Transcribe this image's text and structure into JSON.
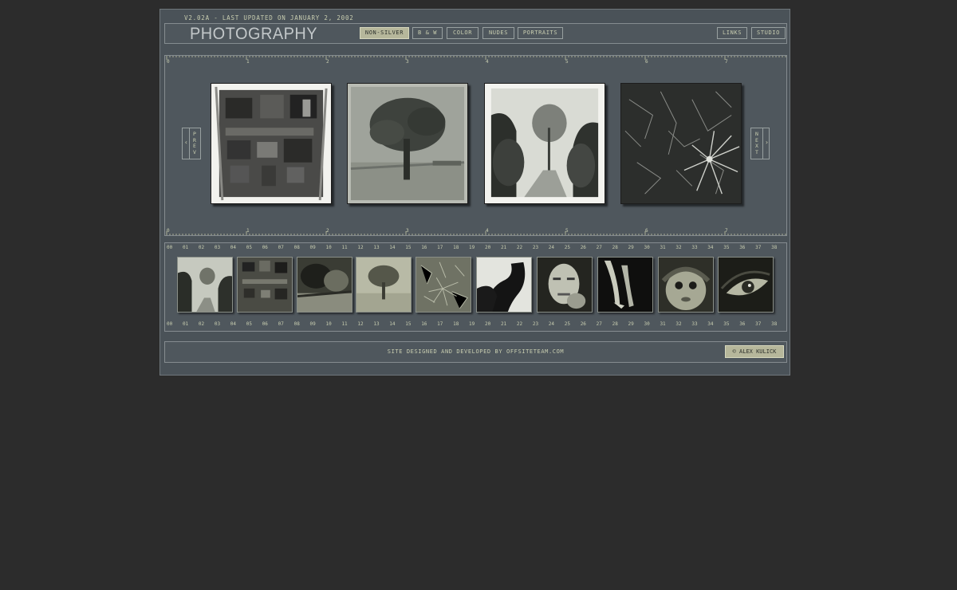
{
  "header": {
    "version": "v2.02a - last updated on january 2, 2002",
    "logo": "PHOTOGRAPHY"
  },
  "nav": {
    "categories": [
      {
        "label": "non-silver",
        "active": true
      },
      {
        "label": "b & w",
        "active": false
      },
      {
        "label": "color",
        "active": false
      },
      {
        "label": "nudes",
        "active": false
      },
      {
        "label": "portraits",
        "active": false
      }
    ],
    "links": [
      {
        "label": "links"
      },
      {
        "label": "studio"
      }
    ]
  },
  "viewer": {
    "ruler_numbers": [
      "0",
      "1",
      "2",
      "3",
      "4",
      "5",
      "6",
      "7"
    ],
    "prev": {
      "arrow": "‹",
      "letters": [
        "p",
        "r",
        "e",
        "v"
      ]
    },
    "next": {
      "arrow": "›",
      "letters": [
        "n",
        "e",
        "x",
        "t"
      ]
    },
    "photos": [
      {
        "icon": "ruined-building-photo"
      },
      {
        "icon": "lone-tree-photo"
      },
      {
        "icon": "tree-lined-road-photo"
      },
      {
        "icon": "frost-crystals-photo"
      }
    ]
  },
  "strip": {
    "frame_numbers": [
      "00",
      "01",
      "02",
      "03",
      "04",
      "05",
      "06",
      "07",
      "08",
      "09",
      "10",
      "11",
      "12",
      "13",
      "14",
      "15",
      "16",
      "17",
      "18",
      "19",
      "20",
      "21",
      "22",
      "23",
      "24",
      "25",
      "26",
      "27",
      "28",
      "29",
      "30",
      "31",
      "32",
      "33",
      "34",
      "35",
      "36",
      "37",
      "38"
    ],
    "thumbnails": [
      {
        "icon": "tree-road-thumb"
      },
      {
        "icon": "ruined-building-thumb"
      },
      {
        "icon": "dark-landscape-thumb"
      },
      {
        "icon": "lone-tree-thumb"
      },
      {
        "icon": "frost-crystals-thumb"
      },
      {
        "icon": "nude-silhouette-thumb"
      },
      {
        "icon": "man-portrait-thumb"
      },
      {
        "icon": "crossed-legs-thumb"
      },
      {
        "icon": "child-portrait-thumb"
      },
      {
        "icon": "eye-closeup-thumb"
      }
    ]
  },
  "footer": {
    "credit_prefix": "site designed and developed by",
    "credit_link": "offsiteteam.com",
    "copyright": "© alex kulick"
  },
  "colors": {
    "background": "#2c2c2c",
    "panel": "#4a5258",
    "accent": "#b6b79b",
    "text": "#c8cdb0"
  }
}
